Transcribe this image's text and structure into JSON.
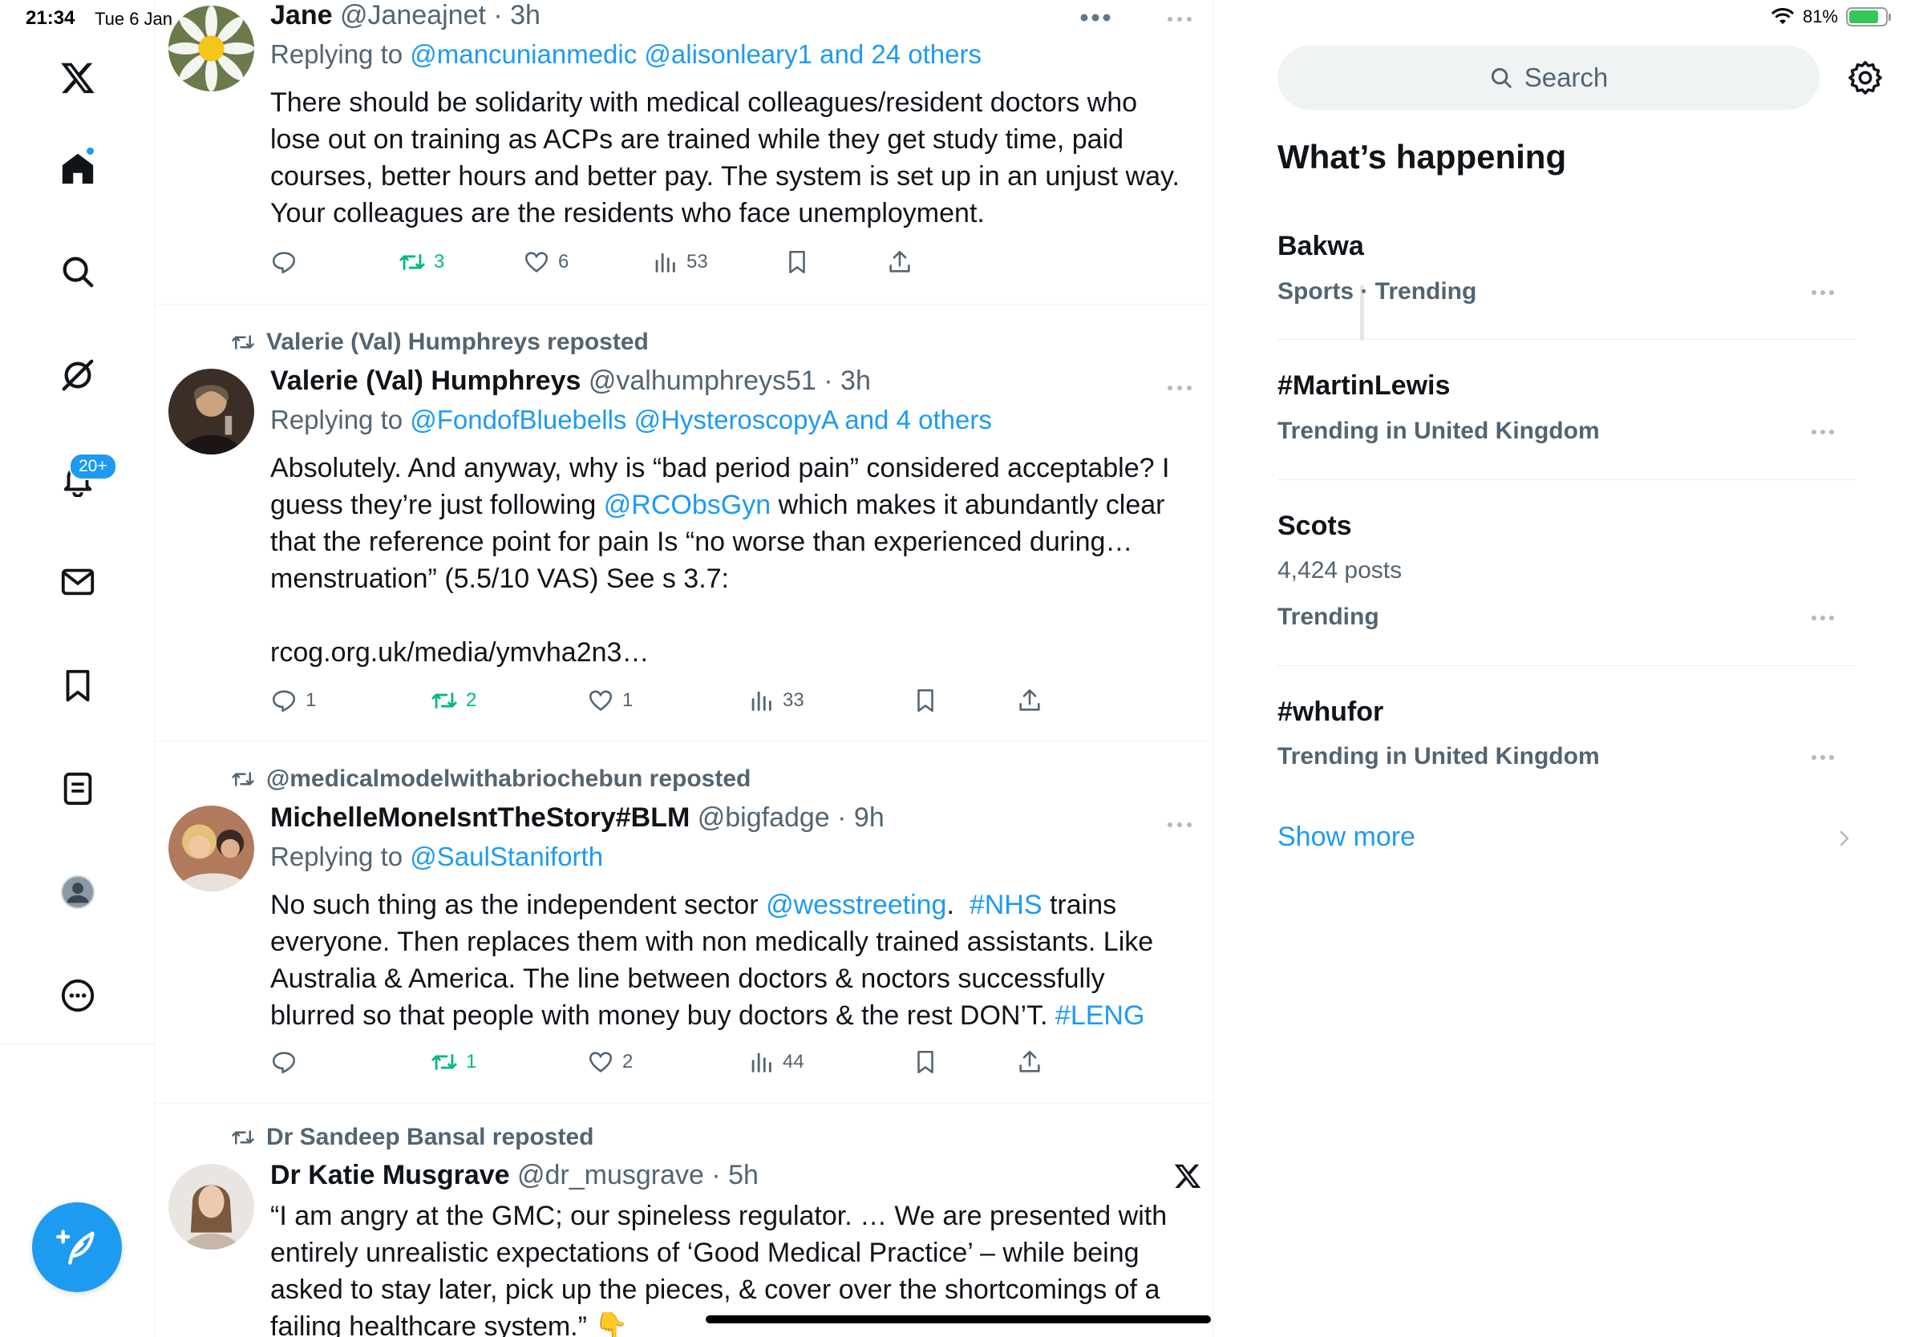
{
  "status_bar": {
    "time": "21:34",
    "date": "Tue 6 Jan",
    "battery": "81%",
    "battery_level": 0.81
  },
  "nav": {
    "notifications_badge": "20+"
  },
  "tweets": [
    {
      "repost_by": "",
      "name": "Jane",
      "handle_time": "@Janeajnet · 3h",
      "replying_prefix": "Replying to ",
      "replying_to": "@mancunianmedic @alisonleary1 and 24 others",
      "body": "There should be solidarity with medical colleagues/resident doctors who lose out on training as ACPs are trained while they get study time, paid courses, better hours and better pay. The system is set up in an unjust way. Your colleagues are the residents who face unemployment.",
      "replies": "",
      "reposts": "3",
      "likes": "6",
      "views": "53"
    },
    {
      "repost_by": "Valerie (Val) Humphreys reposted",
      "name": "Valerie (Val) Humphreys",
      "handle_time": "@valhumphreys51 · 3h",
      "replying_prefix": "Replying to ",
      "replying_to": "@FondofBluebells @HysteroscopyA and 4 others",
      "body_1": "Absolutely. And anyway, why is “bad period pain” considered acceptable? I guess they’re just following ",
      "body_mention": "@RCObsGyn",
      "body_2": " which makes it abundantly clear that the reference point for pain Is “no worse than experienced during… menstruation” (5.5/10 VAS) See s 3.7:",
      "link": "rcog.org.uk/media/ymvha2n3…",
      "replies": "1",
      "reposts": "2",
      "likes": "1",
      "views": "33"
    },
    {
      "repost_by": "@medicalmodelwithabriochebun reposted",
      "name": "MichelleMoneIsntTheStory#BLM",
      "handle_time": "@bigfadge · 9h",
      "replying_prefix": "Replying to ",
      "replying_to": "@SaulStaniforth",
      "body_1": "No such thing as the independent sector ",
      "body_mention": "@wesstreeting",
      "body_sep": ".  ",
      "body_hashtag": "#NHS",
      "body_2": " trains everyone. Then replaces them with non medically trained assistants. Like Australia & America. The line between doctors & noctors successfully blurred so that people with money buy doctors & the rest DON’T. ",
      "body_hashtag2": "#LENG",
      "replies": "",
      "reposts": "1",
      "likes": "2",
      "views": "44"
    },
    {
      "repost_by": "Dr Sandeep Bansal reposted",
      "name": "Dr Katie Musgrave",
      "handle_time": "@dr_musgrave · 5h",
      "body": "“I am angry at the GMC; our spineless regulator. … We are presented with entirely unrealistic expectations of ‘Good Medical Practice’ – while being asked to stay later, pick up the pieces, & cover over the shortcomings of a failing healthcare system.” 👇"
    }
  ],
  "sidebar": {
    "search_placeholder": "Search",
    "heading": "What’s happening",
    "trends": [
      {
        "title": "Bakwa",
        "sub": "Sports · Trending"
      },
      {
        "title": "#MartinLewis",
        "sub": "Trending in United Kingdom"
      },
      {
        "title": "Scots",
        "count": "4,424 posts",
        "sub": "Trending"
      },
      {
        "title": "#whufor",
        "sub": "Trending in United Kingdom"
      }
    ],
    "show_more": "Show more"
  },
  "colors": {
    "accent": "#1d9bf0",
    "repost_green": "#00ba7c",
    "muted": "#536471"
  }
}
